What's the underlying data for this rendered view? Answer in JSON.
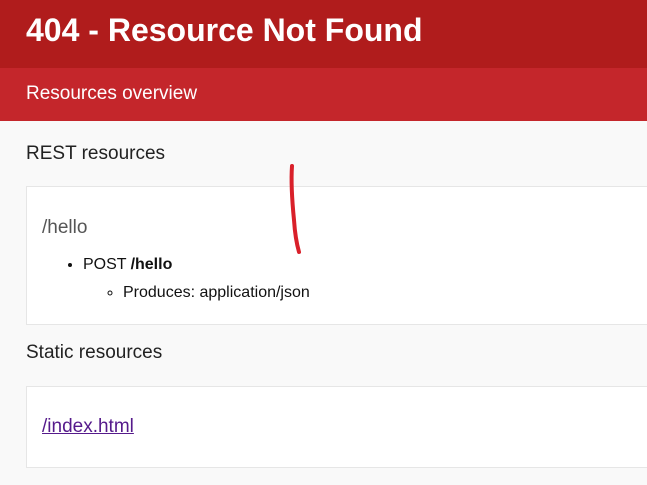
{
  "header": {
    "title": "404 - Resource Not Found"
  },
  "subheader": {
    "label": "Resources overview"
  },
  "rest": {
    "section_title": "REST resources",
    "resources": [
      {
        "path": "/hello",
        "methods": [
          {
            "verb": "POST",
            "path": "/hello",
            "produces": "Produces: application/json"
          }
        ]
      }
    ]
  },
  "static": {
    "section_title": "Static resources",
    "links": [
      {
        "label": "/index.html"
      }
    ]
  },
  "colors": {
    "header_bg": "#b01c1c",
    "subheader_bg": "#c4262b",
    "annotation_stroke": "#d9202a",
    "visited_link": "#551a8b"
  }
}
